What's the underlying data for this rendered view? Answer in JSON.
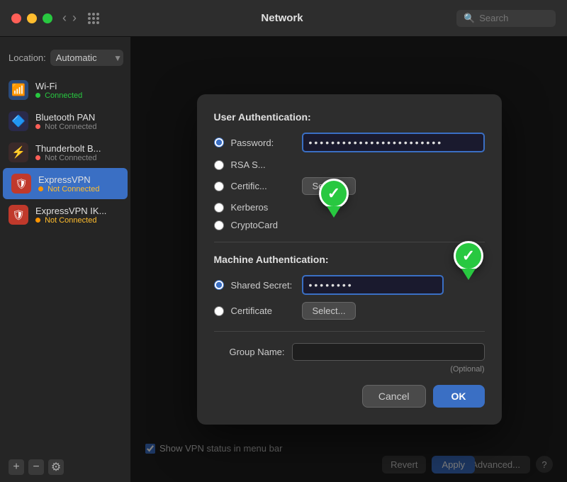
{
  "titleBar": {
    "title": "Network",
    "searchPlaceholder": "Search"
  },
  "sidebar": {
    "locationLabel": "Location:",
    "locationValue": "Automatic",
    "items": [
      {
        "id": "wifi",
        "name": "Wi-Fi",
        "status": "Connected",
        "statusType": "connected",
        "icon": "📶"
      },
      {
        "id": "bluetooth",
        "name": "Bluetooth PAN",
        "status": "Not Connected",
        "statusType": "not-connected",
        "icon": "🔷"
      },
      {
        "id": "thunderbolt",
        "name": "Thunderbolt B...",
        "status": "Not Connected",
        "statusType": "red",
        "icon": "⚡"
      },
      {
        "id": "expressvpn",
        "name": "ExpressVPN",
        "status": "Not Connected",
        "statusType": "orange",
        "icon": "🛡",
        "active": true
      },
      {
        "id": "expressvpn-ike",
        "name": "ExpressVPN IK...",
        "status": "Not Connected",
        "statusType": "orange",
        "icon": "🛡"
      }
    ],
    "addBtn": "+",
    "removeBtn": "−",
    "menuBtn": "⚙"
  },
  "bottomBar": {
    "checkboxLabel": "Show VPN status in menu bar",
    "advancedBtn": "Advanced...",
    "questionBtn": "?",
    "revertBtn": "Revert",
    "applyBtn": "Apply"
  },
  "modal": {
    "userAuthTitle": "User Authentication:",
    "userAuthOptions": [
      {
        "id": "password",
        "label": "Password:",
        "selected": true,
        "hasInput": true,
        "inputValue": "••••••••••••••••••••••••"
      },
      {
        "id": "rsa",
        "label": "RSA S...",
        "selected": false
      },
      {
        "id": "certificate",
        "label": "Certific...",
        "selected": false,
        "hasSelectBtn": true,
        "selectBtnLabel": "Select..."
      },
      {
        "id": "kerberos",
        "label": "Kerberos",
        "selected": false
      },
      {
        "id": "cryptocard",
        "label": "CryptoCard",
        "selected": false
      }
    ],
    "machineAuthTitle": "Machine Authentication:",
    "machineAuthOptions": [
      {
        "id": "shared-secret",
        "label": "Shared Secret:",
        "selected": true,
        "hasInput": true,
        "inputValue": "••••••••"
      },
      {
        "id": "m-certificate",
        "label": "Certificate",
        "selected": false,
        "hasSelectBtn": true,
        "selectBtnLabel": "Select..."
      }
    ],
    "groupNameLabel": "Group Name:",
    "groupNameValue": "",
    "groupNameOptional": "(Optional)",
    "cancelBtn": "Cancel",
    "okBtn": "OK"
  }
}
